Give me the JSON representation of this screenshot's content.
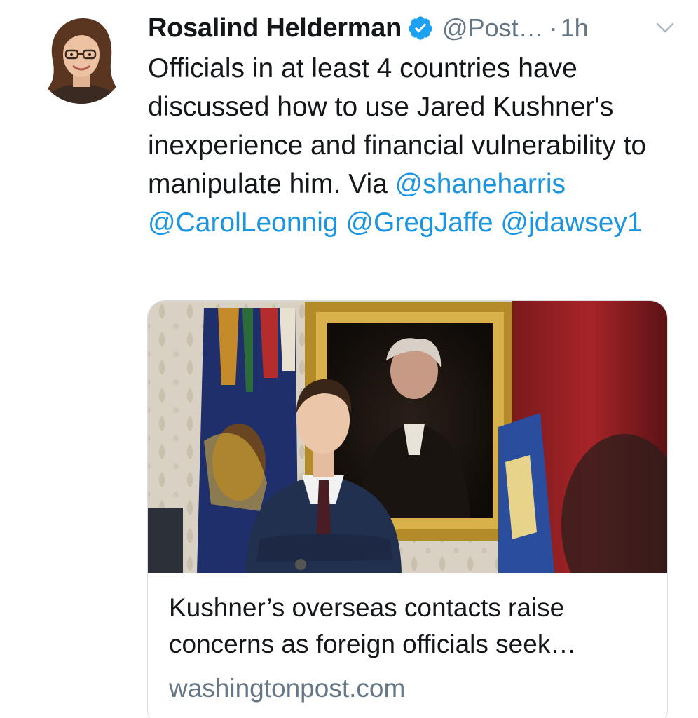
{
  "author": {
    "display_name": "Rosalind Helderman",
    "handle": "@Post…",
    "separator": "·",
    "time": "1h",
    "verified_icon": "verified-badge-icon",
    "menu_icon": "chevron-down-icon",
    "avatar_icon": "avatar"
  },
  "tweet": {
    "text": "Officials in at least 4 countries have discussed how to use Jared Kushner's inexperience and financial vulnerability to manipulate him. Via",
    "mentions": [
      "@shaneharris",
      "@CarolLeonnig",
      "@GregJaffe",
      "@jdawsey1"
    ]
  },
  "card": {
    "title": "Kushner’s overseas contacts raise concerns as foreign officials seek…",
    "domain": "washingtonpost.com"
  },
  "colors": {
    "link": "#1b95e0",
    "secondary_text": "#657786",
    "primary_text": "#14171a",
    "card_border": "#d6dde3",
    "verified": "#1da1f2"
  }
}
